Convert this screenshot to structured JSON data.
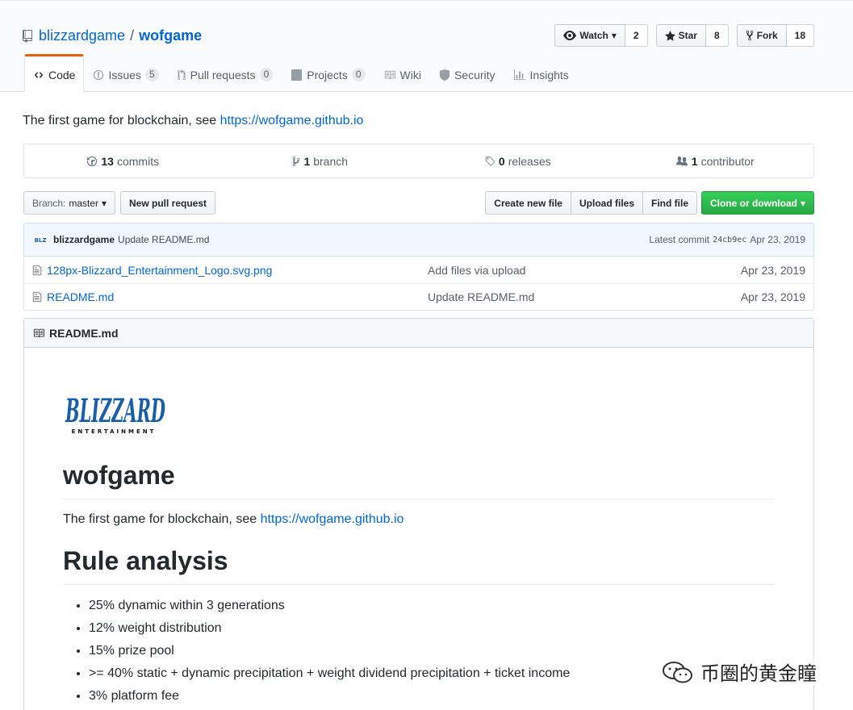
{
  "repo": {
    "owner": "blizzardgame",
    "separator": "/",
    "name": "wofgame"
  },
  "actions": {
    "watch_label": "Watch",
    "watch_count": "2",
    "star_label": "Star",
    "star_count": "8",
    "fork_label": "Fork",
    "fork_count": "18"
  },
  "tabs": [
    {
      "label": "Code"
    },
    {
      "label": "Issues",
      "count": "5"
    },
    {
      "label": "Pull requests",
      "count": "0"
    },
    {
      "label": "Projects",
      "count": "0"
    },
    {
      "label": "Wiki"
    },
    {
      "label": "Security"
    },
    {
      "label": "Insights"
    }
  ],
  "description": {
    "text": "The first game for blockchain, see ",
    "link": "https://wofgame.github.io"
  },
  "numbers": {
    "commits_count": "13",
    "commits_label": "commits",
    "branch_count": "1",
    "branch_label": "branch",
    "releases_count": "0",
    "releases_label": "releases",
    "contributor_count": "1",
    "contributor_label": "contributor"
  },
  "filebar": {
    "branch_prefix": "Branch:",
    "branch_name": "master",
    "new_pr": "New pull request",
    "create_file": "Create new file",
    "upload_files": "Upload files",
    "find_file": "Find file",
    "clone": "Clone or download"
  },
  "latest_commit": {
    "author": "blizzardgame",
    "message": "Update README.md",
    "label": "Latest commit",
    "sha": "24cb9ec",
    "date": "Apr 23, 2019"
  },
  "files": [
    {
      "name": "128px-Blizzard_Entertainment_Logo.svg.png",
      "message": "Add files via upload",
      "age": "Apr 23, 2019"
    },
    {
      "name": "README.md",
      "message": "Update README.md",
      "age": "Apr 23, 2019"
    }
  ],
  "readme": {
    "header": "README.md",
    "logo_text": "BLIZZARD",
    "logo_sub": "ENTERTAINMENT",
    "title": "wofgame",
    "intro_text": "The first game for blockchain, see ",
    "intro_link": "https://wofgame.github.io",
    "section_title": "Rule analysis",
    "rules": [
      "25% dynamic within 3 generations",
      "12% weight distribution",
      "15% prize pool",
      ">= 40% static + dynamic precipitation + weight dividend precipitation + ticket income",
      "3% platform fee"
    ]
  },
  "watermark": {
    "text": "币圈的黄金瞳"
  },
  "colors": {
    "accent": "#0366d6",
    "tab_active": "#e36209",
    "clone_green": "#28a745",
    "logo_blue": "#1a5ea8"
  }
}
